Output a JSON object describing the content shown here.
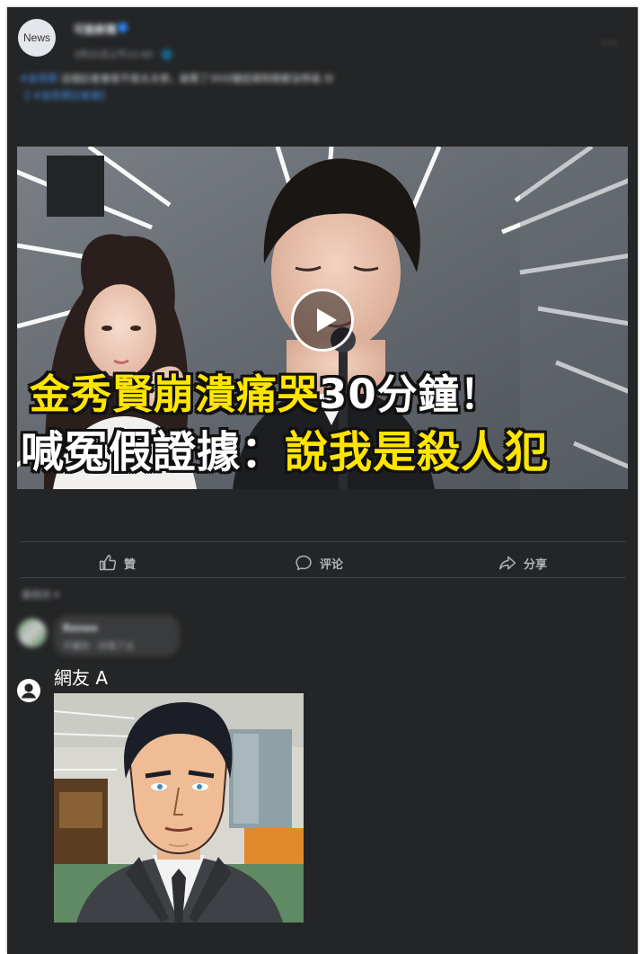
{
  "post": {
    "avatar_label": "News",
    "page_name": "可能新聞",
    "meta": "3月31日上午11:43 · 🌐",
    "more_label": "···",
    "caption_hashtag": "#金秀賢",
    "caption_text": " 這個記者會是不是太太慘，被罵了30分鐘從頭到尾都沒停過 😢",
    "caption_link": "【 #金秀賢記者會】"
  },
  "media": {
    "headline_line1_yellow": "金秀賢崩潰痛哭",
    "headline_line1_white": "30分鐘！",
    "headline_line2_white": "喊冤假證據：",
    "headline_line2_yellow": "說我是殺人犯"
  },
  "actions": {
    "like_label": "贊",
    "comment_label": "评论",
    "share_label": "分享"
  },
  "comments": {
    "sort_label": "最相关 ▾",
    "first": {
      "name": "Renee",
      "text": "不屬你 · 好像了太"
    },
    "second": {
      "name": "網友 A"
    }
  },
  "colors": {
    "background": "#242526",
    "headline_yellow": "#ffe500",
    "link_blue": "#4599ff"
  }
}
